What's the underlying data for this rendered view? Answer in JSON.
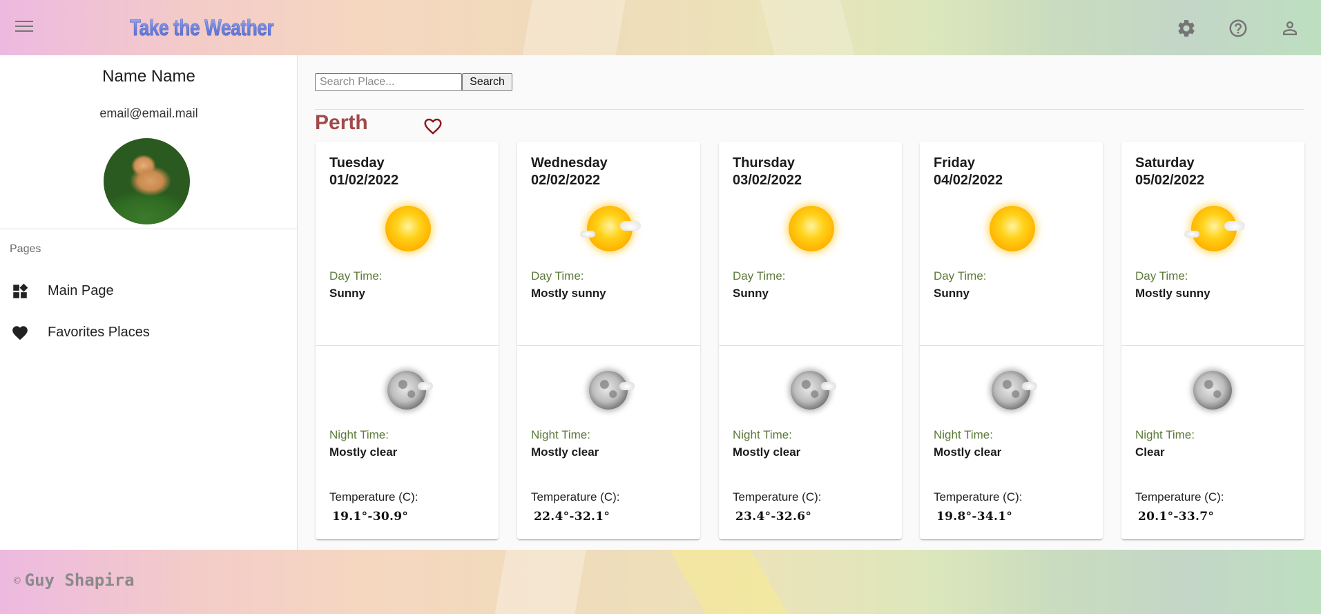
{
  "header": {
    "title": "Take the Weather",
    "icons": [
      "menu-icon",
      "settings-icon",
      "help-icon",
      "account-icon"
    ]
  },
  "sidebar": {
    "user_name": "Name Name",
    "user_email": "email@email.mail",
    "pages_label": "Pages",
    "items": [
      {
        "label": "Main Page",
        "icon": "dashboard-icon"
      },
      {
        "label": "Favorites Places",
        "icon": "heart-icon"
      }
    ]
  },
  "search": {
    "placeholder": "Search Place...",
    "value": "",
    "button_label": "Search"
  },
  "location": {
    "city": "Perth",
    "favorite_icon": "heart-outline-icon"
  },
  "labels": {
    "day_time": "Day Time:",
    "night_time": "Night Time:",
    "temperature": "Temperature (C):"
  },
  "forecast": [
    {
      "day": "Tuesday",
      "date": "01/02/2022",
      "day_condition": "Sunny",
      "night_condition": "Mostly clear",
      "temp_range": "19.1°-30.9°"
    },
    {
      "day": "Wednesday",
      "date": "02/02/2022",
      "day_condition": "Mostly sunny",
      "night_condition": "Mostly clear",
      "temp_range": "22.4°-32.1°"
    },
    {
      "day": "Thursday",
      "date": "03/02/2022",
      "day_condition": "Sunny",
      "night_condition": "Mostly clear",
      "temp_range": "23.4°-32.6°"
    },
    {
      "day": "Friday",
      "date": "04/02/2022",
      "day_condition": "Sunny",
      "night_condition": "Mostly clear",
      "temp_range": "19.8°-34.1°"
    },
    {
      "day": "Saturday",
      "date": "05/02/2022",
      "day_condition": "Mostly sunny",
      "night_condition": "Clear",
      "temp_range": "20.1°-33.7°"
    }
  ],
  "footer": {
    "symbol": "©",
    "author": "Guy Shapira"
  },
  "colors": {
    "city": "#a14a4a",
    "label_green": "#5c7a3a",
    "title_blue": "#6f86e6"
  }
}
